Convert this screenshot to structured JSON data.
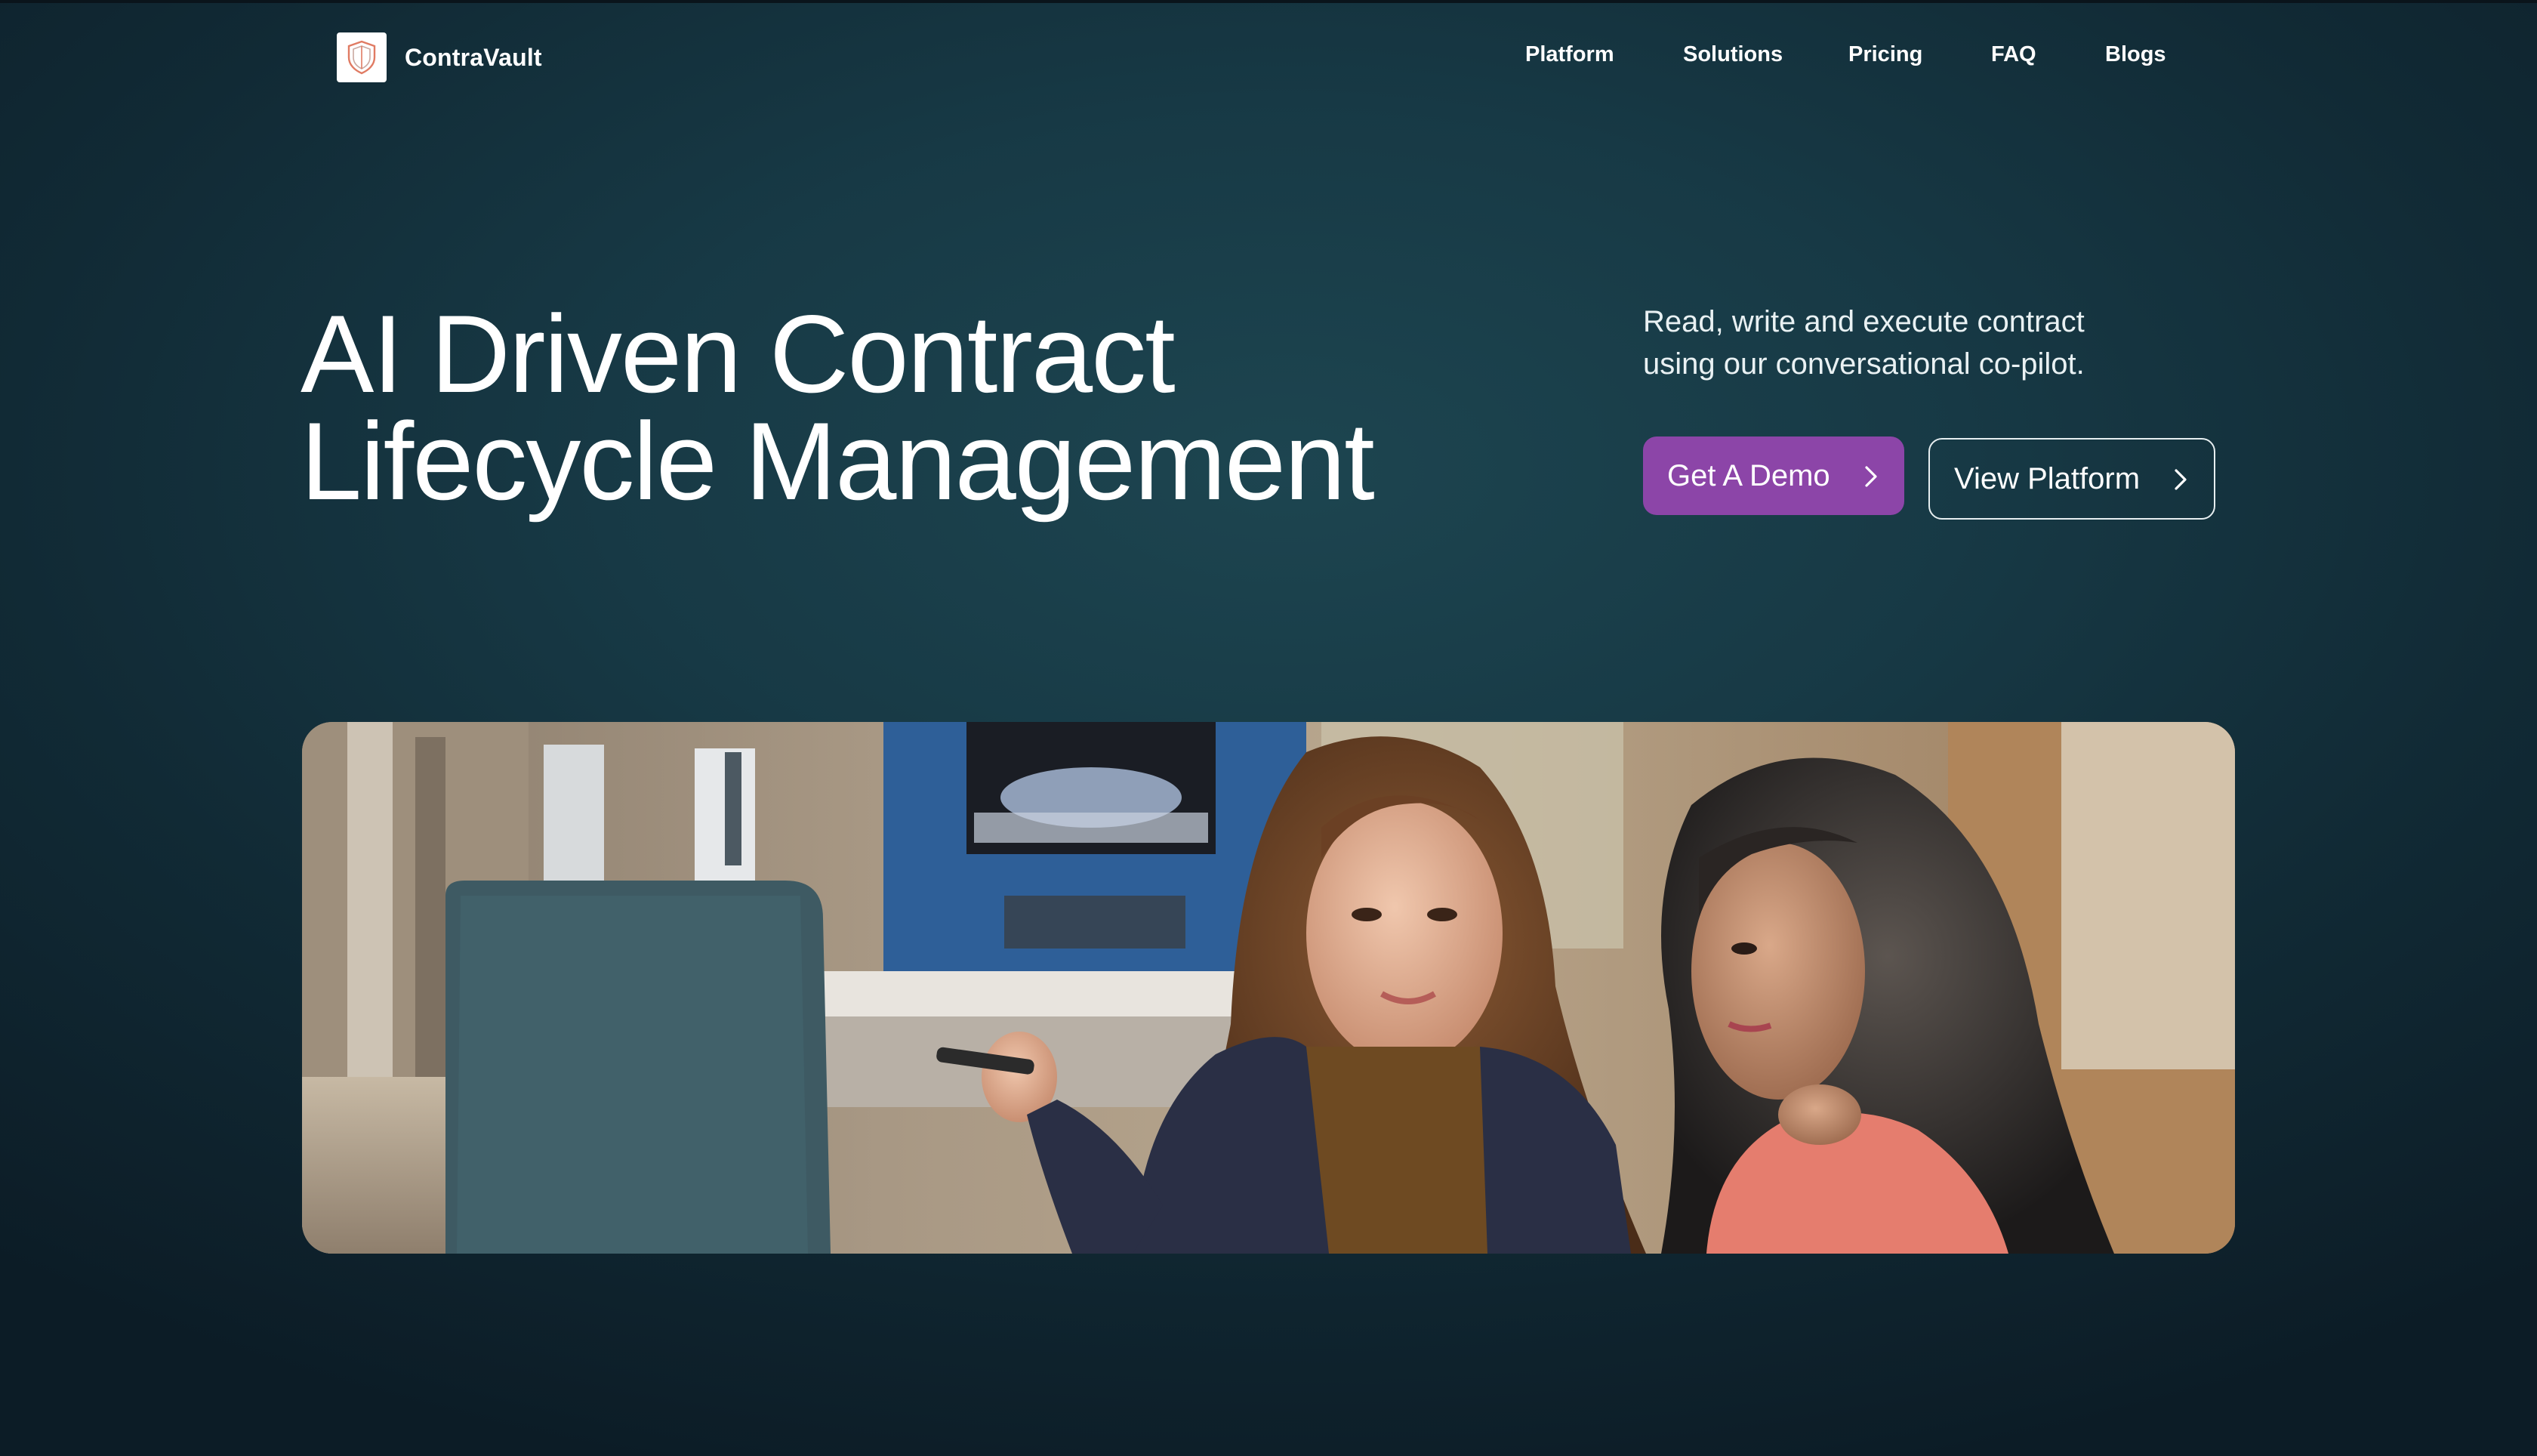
{
  "brand": {
    "name": "ContraVault",
    "logo_icon": "shield-icon",
    "accent": "#e07b63"
  },
  "nav": {
    "items": [
      {
        "label": "Platform"
      },
      {
        "label": "Solutions"
      },
      {
        "label": "Pricing"
      },
      {
        "label": "FAQ"
      },
      {
        "label": "Blogs"
      }
    ]
  },
  "hero": {
    "title_line1": "AI Driven Contract",
    "title_line2": "Lifecycle Management",
    "subtitle_line1": "Read, write and execute contract",
    "subtitle_line2": "using our conversational co-pilot.",
    "primary_button": {
      "label": "Get A Demo",
      "icon": "chevron-right-icon",
      "color": "#8c45a8"
    },
    "secondary_button": {
      "label": "View Platform",
      "icon": "chevron-right-icon"
    }
  },
  "colors": {
    "background": "#173945",
    "text": "#ffffff"
  }
}
